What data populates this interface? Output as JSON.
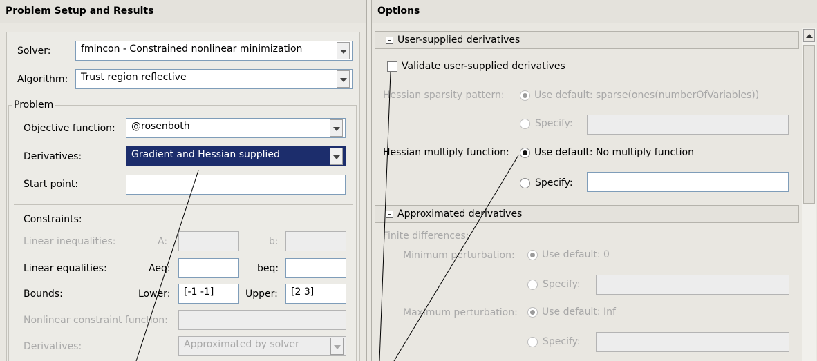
{
  "left_panel": {
    "title": "Problem Setup and Results",
    "solver_label": "Solver:",
    "solver_value": "fmincon - Constrained nonlinear minimization",
    "algorithm_label": "Algorithm:",
    "algorithm_value": "Trust region reflective",
    "problem_group": "Problem",
    "objective_label": "Objective function:",
    "objective_value": "@rosenboth",
    "derivatives_label": "Derivatives:",
    "derivatives_value": "Gradient and Hessian supplied",
    "start_point_label": "Start point:",
    "start_point_value": "",
    "constraints_label": "Constraints:",
    "linear_ineq_label": "Linear inequalities:",
    "a_label": "A:",
    "b_label": "b:",
    "linear_eq_label": "Linear equalities:",
    "aeq_label": "Aeq:",
    "beq_label": "beq:",
    "bounds_label": "Bounds:",
    "lower_label": "Lower:",
    "lower_value": "[-1 -1]",
    "upper_label": "Upper:",
    "upper_value": "[2 3]",
    "nonlin_label": "Nonlinear constraint function:",
    "nonlin_deriv_label": "Derivatives:",
    "nonlin_deriv_value": "Approximated by solver"
  },
  "right_panel": {
    "title": "Options",
    "user_supplied_section": "User-supplied derivatives",
    "validate_label": "Validate user-supplied derivatives",
    "validate_checked": false,
    "hessian_sparsity_label": "Hessian sparsity pattern:",
    "hessian_sparsity_default": "Use default: sparse(ones(numberOfVariables))",
    "specify_label": "Specify:",
    "hessian_multiply_label": "Hessian multiply function:",
    "hessian_multiply_default": "Use default: No multiply function",
    "approx_section": "Approximated derivatives",
    "finite_diff_label": "Finite differences:",
    "min_perturb_label": "Minimum perturbation:",
    "min_perturb_default": "Use default: 0",
    "max_perturb_label": "Maximum perturbation:",
    "max_perturb_default": "Use default: Inf"
  },
  "colors": {
    "header_bg": "#e4e2dc",
    "selection": "#1c2d6c",
    "disabled_text": "#a8a8a8"
  }
}
